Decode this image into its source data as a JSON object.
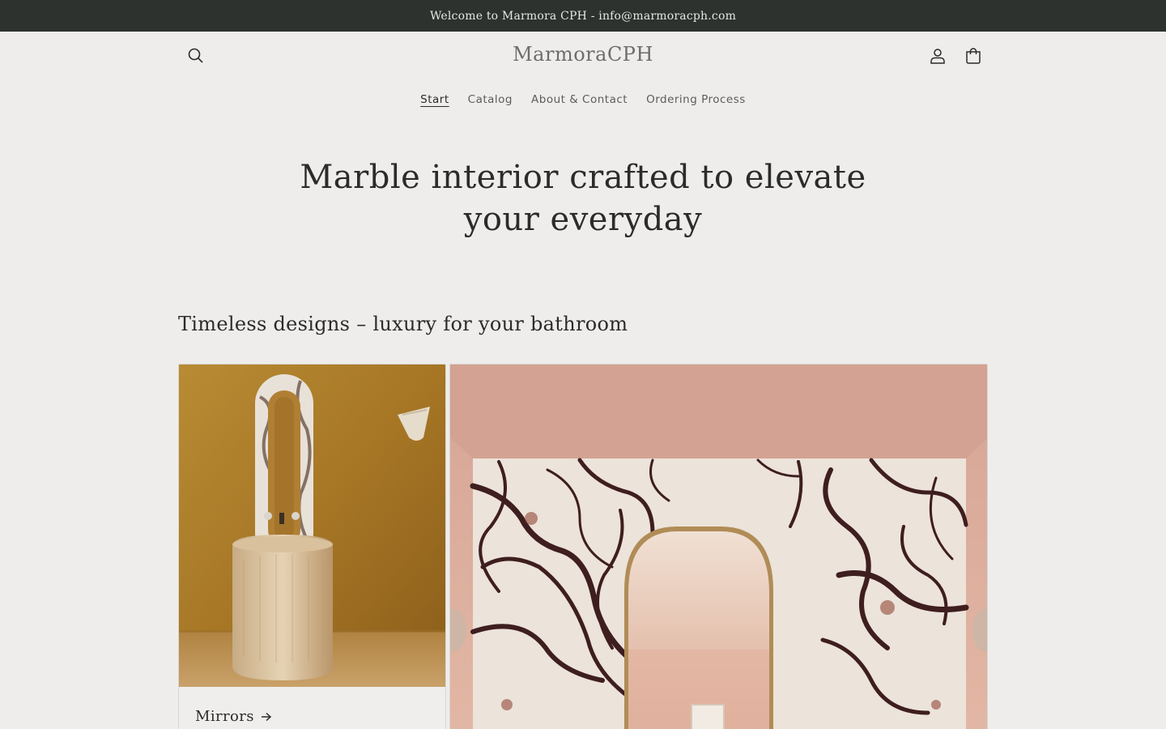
{
  "announcement": "Welcome to Marmora CPH - info@marmoracph.com",
  "header": {
    "logo": "MarmoraCPH",
    "search_icon": "search-icon",
    "account_icon": "user-icon",
    "cart_icon": "bag-icon"
  },
  "nav": {
    "items": [
      {
        "label": "Start",
        "active": true
      },
      {
        "label": "Catalog"
      },
      {
        "label": "About & Contact"
      },
      {
        "label": "Ordering Process"
      }
    ]
  },
  "hero": {
    "title": "Marble interior crafted to elevate your everyday"
  },
  "collections": {
    "title": "Timeless designs – luxury for your bathroom",
    "cards": [
      {
        "label": "Mirrors",
        "arrow_icon": "arrow-right-icon"
      }
    ]
  },
  "colors": {
    "announcement_bg": "#2d322f",
    "page_bg": "#eeedeb",
    "text": "#2b2b2b"
  }
}
